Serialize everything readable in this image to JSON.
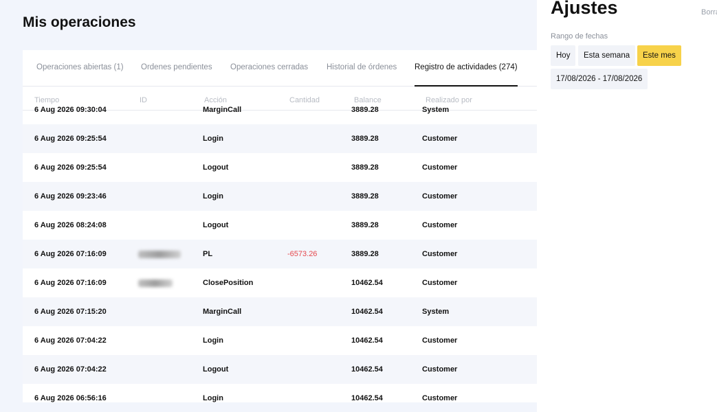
{
  "page": {
    "title": "Mis operaciones"
  },
  "tabs": [
    {
      "label": "Operaciones abiertas (1)",
      "active": false
    },
    {
      "label": "Ordenes pendientes",
      "active": false
    },
    {
      "label": "Operaciones cerradas",
      "active": false
    },
    {
      "label": "Historial de órdenes",
      "active": false
    },
    {
      "label": "Registro de actividades (274)",
      "active": true
    }
  ],
  "table": {
    "columns": [
      "Tiempo",
      "ID",
      "Acción",
      "Cantidad",
      "Balance",
      "Realizado por"
    ],
    "rows": [
      {
        "time": "6 Aug 2026 09:30:04",
        "id_redacted": false,
        "action": "MarginCall",
        "amount": "",
        "balance": "3889.28",
        "by": "System"
      },
      {
        "time": "6 Aug 2026 09:25:54",
        "id_redacted": false,
        "action": "Login",
        "amount": "",
        "balance": "3889.28",
        "by": "Customer"
      },
      {
        "time": "6 Aug 2026 09:25:54",
        "id_redacted": false,
        "action": "Logout",
        "amount": "",
        "balance": "3889.28",
        "by": "Customer"
      },
      {
        "time": "6 Aug 2026 09:23:46",
        "id_redacted": false,
        "action": "Login",
        "amount": "",
        "balance": "3889.28",
        "by": "Customer"
      },
      {
        "time": "6 Aug 2026 08:24:08",
        "id_redacted": false,
        "action": "Logout",
        "amount": "",
        "balance": "3889.28",
        "by": "Customer"
      },
      {
        "time": "6 Aug 2026 07:16:09",
        "id_redacted": true,
        "action": "PL",
        "amount": "-6573.26",
        "balance": "3889.28",
        "by": "Customer"
      },
      {
        "time": "6 Aug 2026 07:16:09",
        "id_redacted": true,
        "action": "ClosePosition",
        "amount": "",
        "balance": "10462.54",
        "by": "Customer"
      },
      {
        "time": "6 Aug 2026 07:15:20",
        "id_redacted": false,
        "action": "MarginCall",
        "amount": "",
        "balance": "10462.54",
        "by": "System"
      },
      {
        "time": "6 Aug 2026 07:04:22",
        "id_redacted": false,
        "action": "Login",
        "amount": "",
        "balance": "10462.54",
        "by": "Customer"
      },
      {
        "time": "6 Aug 2026 07:04:22",
        "id_redacted": false,
        "action": "Logout",
        "amount": "",
        "balance": "10462.54",
        "by": "Customer"
      },
      {
        "time": "6 Aug 2026 06:56:16",
        "id_redacted": false,
        "action": "Login",
        "amount": "",
        "balance": "10462.54",
        "by": "Customer"
      }
    ]
  },
  "panel": {
    "title": "Ajustes",
    "clear_label": "Borrar",
    "date_range_label": "Rango de fechas",
    "chips": [
      {
        "label": "Hoy",
        "active": false
      },
      {
        "label": "Esta semana",
        "active": false
      },
      {
        "label": "Este mes",
        "active": true
      }
    ],
    "date_range_value": "17/08/2026 - 17/08/2026"
  },
  "colors": {
    "accent": "#f7d24a",
    "negative": "#e5484d",
    "background": "#f2f5fc"
  }
}
